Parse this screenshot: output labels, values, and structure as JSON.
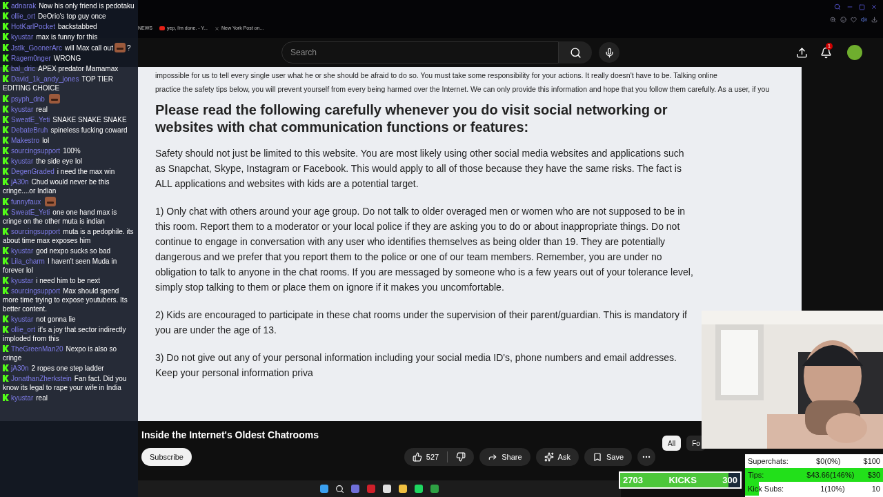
{
  "browser": {
    "tabs": [
      {
        "label": "NEWS",
        "kind": "plain"
      },
      {
        "label": "yep, i'm done. - Y...",
        "kind": "video"
      },
      {
        "label": "New York Post on...",
        "kind": "x"
      }
    ]
  },
  "header": {
    "search": {
      "placeholder": "Search"
    },
    "notifications": "1"
  },
  "document": {
    "lines": [
      "impossible for us to tell every single user what he or she should be afraid to do so. You must take some responsibility for your actions. It really doesn't have to be. Talking online",
      "practice the safety tips below, you will prevent yourself from every being harmed over the Internet. We can only provide this information and hope that you follow them carefully. As a user, if you"
    ],
    "heading": "Please read the following carefully whenever you do visit social networking or websites with chat communication functions or features:",
    "paragraphs": [
      "Safety should not just be limited to this website. You are most likely using other social media websites and applications such as Snapchat, Skype, Instagram or Facebook. This would apply to all of those because they have the same risks. The fact is ALL applications and websites with kids are a potential target.",
      "1) Only chat with others around your age group. Do not talk to older overaged men or women who are not supposed to be in this room. Report them to a moderator or your local police if they are asking you to do or about inappropriate things. Do not continue to engage in conversation with any user who identifies themselves as being older than 19. They are potentially dangerous and we prefer that you report them to the police or one of our team members. Remember, you are under no obligation to talk to anyone in the chat rooms. If you are messaged by someone who is a few years out of your tolerance level, simply stop talking to them or place them on ignore if it makes you uncomfortable.",
      "2) Kids are encouraged to participate in these chat rooms under the supervision of their parent/guardian. This is mandatory if you are under the age of 13.",
      "3) Do not give out any of your personal information including your social media ID's, phone numbers and email addresses. Keep your personal information priva"
    ]
  },
  "video": {
    "title": "Inside the Internet's Oldest Chatrooms",
    "subscribe": "Subscribe",
    "likes": "527",
    "share": "Share",
    "ask": "Ask",
    "save": "Save"
  },
  "chips": [
    {
      "label": "All",
      "selected": true
    },
    {
      "label": "Fo",
      "selected": false
    }
  ],
  "chat": [
    {
      "user": "adnarak",
      "text": "Now his only friend is pedotaku",
      "kind": "text"
    },
    {
      "user": "ollie_ort",
      "text": "DeOrio's top guy once",
      "kind": "text"
    },
    {
      "user": "HotKarlPocket",
      "text": "backstabbed",
      "kind": "text"
    },
    {
      "user": "kyustar",
      "text": "max is funny for this",
      "kind": "text"
    },
    {
      "user": "Jstlk_GoonerArc",
      "text": "will Max call out",
      "kind": "text_emote",
      "suffix": "?"
    },
    {
      "user": "Ragem0nger",
      "text": "WRONG",
      "kind": "text"
    },
    {
      "user": "bal_dric",
      "text": "APEX predator Mamamax",
      "kind": "text"
    },
    {
      "user": "David_1k_andy_jones",
      "text": "TOP TIER EDITING CHOICE",
      "kind": "text"
    },
    {
      "user": "psyph_dnb",
      "kind": "emote"
    },
    {
      "user": "kyustar",
      "text": "real",
      "kind": "text"
    },
    {
      "user": "SweatE_Yeti",
      "text": "SNAKE SNAKE SNAKE",
      "kind": "text"
    },
    {
      "user": "DebateBruh",
      "text": "spineless fucking coward",
      "kind": "text"
    },
    {
      "user": "Makestro",
      "text": "lol",
      "kind": "text"
    },
    {
      "user": "sourcingsupport",
      "text": "100%",
      "kind": "text"
    },
    {
      "user": "kyustar",
      "text": "the side eye lol",
      "kind": "text"
    },
    {
      "user": "DegenGraded",
      "text": "i need the max win",
      "kind": "text"
    },
    {
      "user": "jA30n",
      "text": "Chud would never be this cringe....or Indian",
      "kind": "text"
    },
    {
      "user": "funnyfaux",
      "kind": "emote"
    },
    {
      "user": "SweatE_Yeti",
      "text": "one one hand max is cringe on the other muta is indian",
      "kind": "text"
    },
    {
      "user": "sourcingsupport",
      "text": "muta is a pedophile. its about time max exposes him",
      "kind": "text"
    },
    {
      "user": "kyustar",
      "text": "god nexpo sucks so bad",
      "kind": "text"
    },
    {
      "user": "Lila_charm",
      "text": "I haven't seen Muda in forever lol",
      "kind": "text"
    },
    {
      "user": "kyustar",
      "text": "i need him to be next",
      "kind": "text"
    },
    {
      "user": "sourcingsupport",
      "text": "Max should spend more time trying to expose youtubers. Its better content.",
      "kind": "text"
    },
    {
      "user": "kyustar",
      "text": "not gonna lie",
      "kind": "text"
    },
    {
      "user": "ollie_ort",
      "text": "it's a joy that sector indirectly imploded from this",
      "kind": "text"
    },
    {
      "user": "TheGreenMan20",
      "text": "Nexpo is also so cringe",
      "kind": "text"
    },
    {
      "user": "jA30n",
      "text": "2 ropes one step ladder",
      "kind": "text"
    },
    {
      "user": "JonathanZherkstein",
      "text": "Fan fact. Did you know its legal to rape your wife in India",
      "kind": "text"
    },
    {
      "user": "kyustar",
      "text": "real",
      "kind": "text"
    }
  ],
  "kicks": {
    "count": "2703",
    "label": "KICKS",
    "goal": "300",
    "level": 0.9
  },
  "stats": [
    {
      "label": "Superchats:",
      "value": "$0(0%)",
      "goal": "$100",
      "level": 0
    },
    {
      "label": "Tips:",
      "value": "$43.66(146%)",
      "goal": "$30",
      "level": 1
    },
    {
      "label": "Kick Subs:",
      "value": "1(10%)",
      "goal": "10",
      "level": 0.1
    }
  ]
}
